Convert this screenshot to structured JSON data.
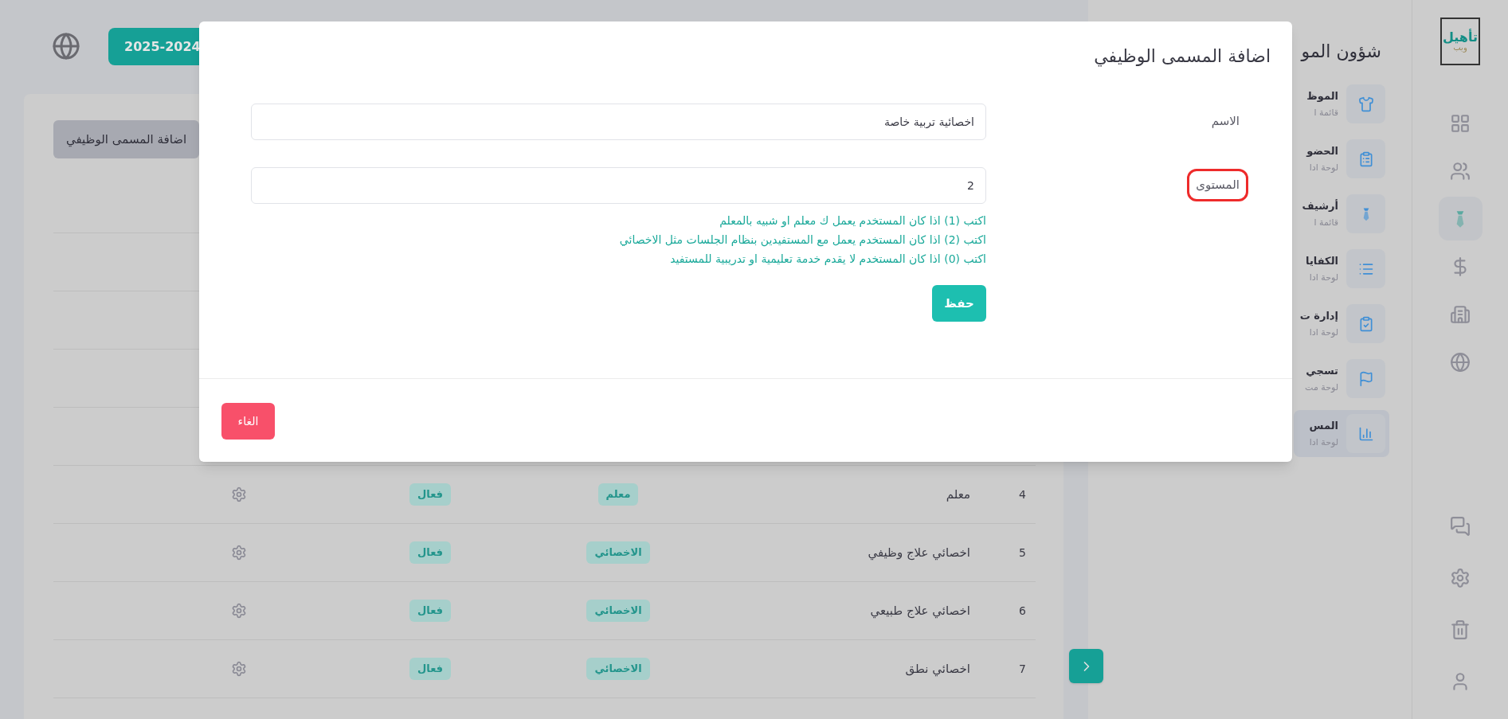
{
  "rail": {
    "logo": {
      "main": "تأهيل",
      "sub": "ويب"
    },
    "top_icons": [
      {
        "selected": false
      },
      {
        "selected": false
      },
      {
        "selected": true
      },
      {
        "selected": false
      },
      {
        "selected": false
      },
      {
        "selected": false
      }
    ],
    "bottom_icons": [
      {
        "selected": false
      },
      {
        "selected": false
      },
      {
        "selected": false
      },
      {
        "selected": false
      }
    ]
  },
  "sidebar": {
    "title": "شؤون المو",
    "items": [
      {
        "title": "الموظ",
        "subtitle": "قائمة ا",
        "selected": false
      },
      {
        "title": "الحضو",
        "subtitle": "لوحة ادا",
        "selected": false
      },
      {
        "title": "أرشيف",
        "subtitle": "قائمة ا",
        "selected": false
      },
      {
        "title": "الكفايا",
        "subtitle": "لوحة ادا",
        "selected": false
      },
      {
        "title": "إدارة ت",
        "subtitle": "لوحة ادا",
        "selected": false
      },
      {
        "title": "تسجي",
        "subtitle": "لوحة مت",
        "selected": false
      },
      {
        "title": "المس",
        "subtitle": "لوحة ادا",
        "selected": true
      }
    ]
  },
  "header": {
    "year_button": "2025-2024"
  },
  "add_button": "اضافة المسمى الوظيفي",
  "table": {
    "rows": [
      {
        "number": "4",
        "name": "معلم",
        "type": "معلم",
        "status": "فعال"
      },
      {
        "number": "5",
        "name": "اخصائي علاج وظيفي",
        "type": "الاخصائي",
        "status": "فعال"
      },
      {
        "number": "6",
        "name": "اخصائي علاج طبيعي",
        "type": "الاخصائي",
        "status": "فعال"
      },
      {
        "number": "7",
        "name": "اخصائي نطق",
        "type": "الاخصائي",
        "status": "فعال"
      }
    ]
  },
  "modal": {
    "title": "اضافة المسمى الوظيفي",
    "fields": [
      {
        "label": "الاسم",
        "value": "اخصائية تربية خاصة",
        "highlighted": false
      },
      {
        "label": "المستوى",
        "value": "2",
        "highlighted": true
      }
    ],
    "hints": [
      "اكتب (1) اذا كان المستخدم يعمل ك معلم او شبيه بالمعلم",
      "اكتب (2) اذا كان المستخدم يعمل مع المستفيدين بنظام الجلسات مثل الاخصائي",
      "اكتب (0) اذا كان المستخدم لا يقدم خدمة تعليمية او تدريبية للمستفيد"
    ],
    "save_button": "حفظ",
    "cancel_button": "الغاء"
  }
}
